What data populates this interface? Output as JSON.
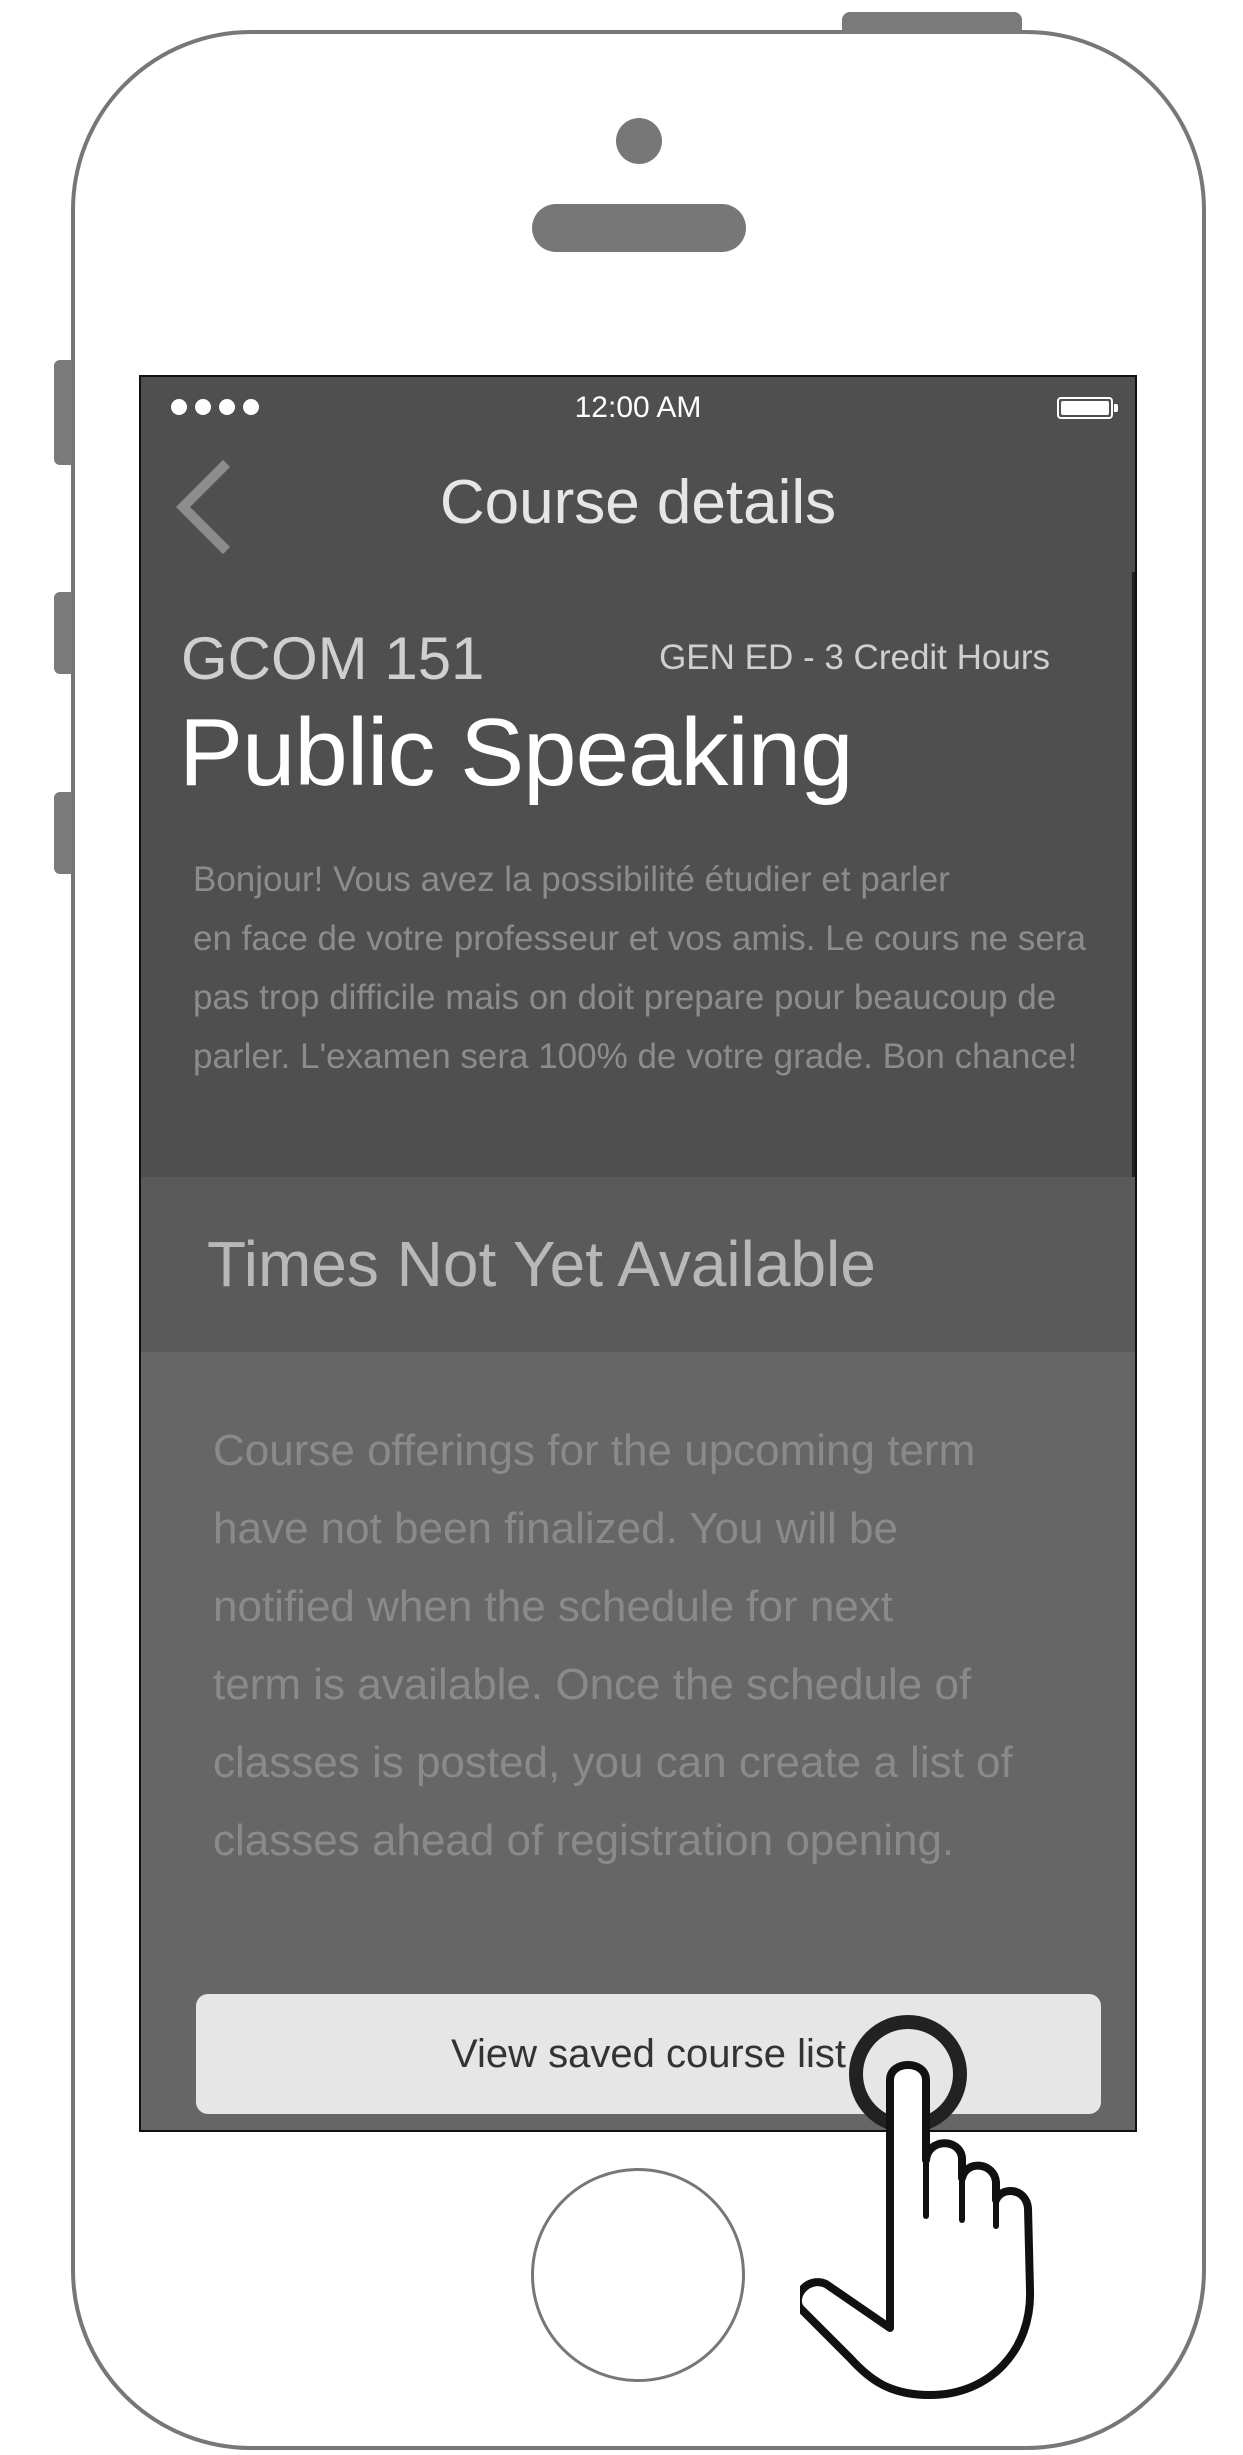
{
  "status_bar": {
    "time": "12:00 AM"
  },
  "nav": {
    "title": "Course details"
  },
  "course": {
    "code": "GCOM 151",
    "credit_info": "GEN ED - 3 Credit Hours",
    "title": "Public Speaking",
    "description_lines": [
      "Bonjour! Vous avez la possibilité étudier et parler",
      "en face de votre professeur et vos amis. Le cours ne sera",
      "pas trop difficile mais on doit prepare pour beaucoup de",
      "parler. L'examen sera 100% de votre grade. Bon chance!"
    ]
  },
  "schedule": {
    "heading": "Times Not Yet Available",
    "notice_lines": [
      "Course offerings for the upcoming term",
      "have not been finalized. You will be",
      "notified when the schedule for next",
      "term is available. Once the schedule of",
      "classes is posted, you can create a list of",
      "classes ahead of registration opening."
    ]
  },
  "actions": {
    "view_saved_label": "View saved course list"
  },
  "colors": {
    "header_bg": "#4f4f4f",
    "screen_bg": "#666666",
    "button_bg": "#e6e6e6",
    "frame": "#777777"
  },
  "icons": {
    "back": "chevron-left-icon",
    "signal": "signal-dots-icon",
    "battery": "battery-icon",
    "gesture": "tap-hand-icon"
  }
}
